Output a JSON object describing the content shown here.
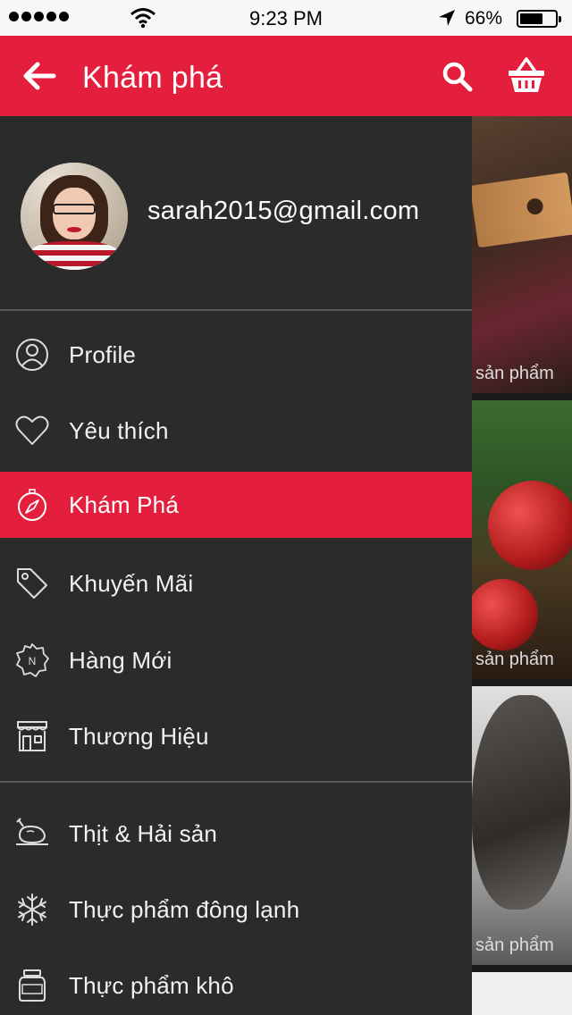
{
  "status_bar": {
    "time": "9:23 PM",
    "battery": "66%"
  },
  "header": {
    "title": "Khám phá",
    "back_icon": "arrow-left-icon",
    "search_icon": "search-icon",
    "cart_icon": "basket-icon"
  },
  "drawer": {
    "user": {
      "email": "sarah2015@gmail.com"
    },
    "primary_items": [
      {
        "label": "Profile",
        "icon": "user-circle-icon"
      },
      {
        "label": "Yêu thích",
        "icon": "heart-icon"
      },
      {
        "label": "Khám Phá",
        "icon": "compass-icon",
        "active": true
      },
      {
        "label": "Khuyến Mãi",
        "icon": "tag-icon"
      },
      {
        "label": "Hàng Mới",
        "icon": "new-badge-icon"
      },
      {
        "label": "Thương Hiệu",
        "icon": "storefront-icon"
      }
    ],
    "category_items": [
      {
        "label": "Thịt & Hải sản",
        "icon": "roast-chicken-icon"
      },
      {
        "label": "Thực phẩm đông lạnh",
        "icon": "snowflake-icon"
      },
      {
        "label": "Thực phẩm khô",
        "icon": "jar-icon"
      }
    ]
  },
  "background": {
    "card_caption": "sản phẩm"
  },
  "colors": {
    "accent": "#e41f3d",
    "drawer_bg": "#2b2b2b"
  }
}
